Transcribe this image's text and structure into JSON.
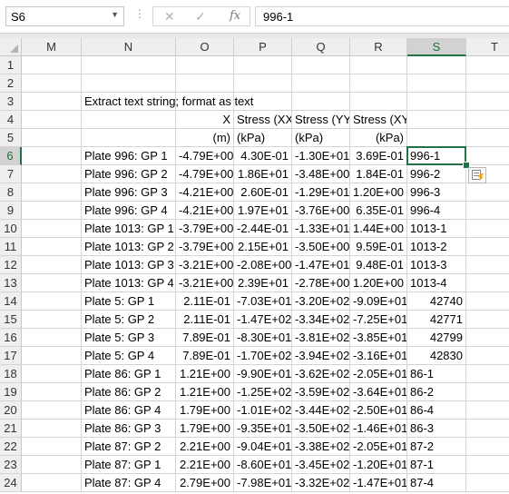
{
  "formula_bar": {
    "name_box": "S6",
    "formula": "996-1",
    "cancel_glyph": "✕",
    "enter_glyph": "✓",
    "fx_label": "fx"
  },
  "columns": [
    "M",
    "N",
    "O",
    "P",
    "Q",
    "R",
    "S",
    "T"
  ],
  "selected_column": "S",
  "selected_row": 6,
  "rows": [
    {
      "n": "1",
      "N": "",
      "O": "",
      "P": "",
      "Q": "",
      "R": "",
      "S": ""
    },
    {
      "n": "2",
      "N": "",
      "O": "",
      "P": "",
      "Q": "",
      "R": "",
      "S": ""
    },
    {
      "n": "3",
      "N": "Extract text string; format as text",
      "O": "",
      "P": "",
      "Q": "",
      "R": "",
      "S": ""
    },
    {
      "n": "4",
      "N": "",
      "O": "X",
      "P": "Stress (XX",
      "Q": "Stress (YY",
      "R": "Stress (XY)",
      "S": ""
    },
    {
      "n": "5",
      "N": "",
      "O": "(m)",
      "P": "(kPa)",
      "Q": "(kPa)",
      "R": "(kPa)",
      "S": ""
    },
    {
      "n": "6",
      "N": "Plate 996: GP 1",
      "O": "-4.79E+00",
      "P": "4.30E-01",
      "Q": "-1.30E+01",
      "R": "3.69E-01",
      "S": "996-1"
    },
    {
      "n": "7",
      "N": "Plate 996: GP 2",
      "O": "-4.79E+00",
      "P": "1.86E+01",
      "Q": "-3.48E+00",
      "R": "1.84E-01",
      "S": "996-2"
    },
    {
      "n": "8",
      "N": "Plate 996: GP 3",
      "O": "-4.21E+00",
      "P": "2.60E-01",
      "Q": "-1.29E+01",
      "R": "1.20E+00",
      "S": "996-3"
    },
    {
      "n": "9",
      "N": "Plate 996: GP 4",
      "O": "-4.21E+00",
      "P": "1.97E+01",
      "Q": "-3.76E+00",
      "R": "6.35E-01",
      "S": "996-4"
    },
    {
      "n": "10",
      "N": "Plate 1013: GP 1",
      "O": "-3.79E+00",
      "P": "-2.44E-01",
      "Q": "-1.33E+01",
      "R": "1.44E+00",
      "S": "1013-1"
    },
    {
      "n": "11",
      "N": "Plate 1013: GP 2",
      "O": "-3.79E+00",
      "P": "2.15E+01",
      "Q": "-3.50E+00",
      "R": "9.59E-01",
      "S": "1013-2"
    },
    {
      "n": "12",
      "N": "Plate 1013: GP 3",
      "O": "-3.21E+00",
      "P": "-2.08E+00",
      "Q": "-1.47E+01",
      "R": "9.48E-01",
      "S": "1013-3"
    },
    {
      "n": "13",
      "N": "Plate 1013: GP 4",
      "O": "-3.21E+00",
      "P": "2.39E+01",
      "Q": "-2.78E+00",
      "R": "1.20E+00",
      "S": "1013-4"
    },
    {
      "n": "14",
      "N": "Plate 5: GP 1",
      "O": "2.11E-01",
      "P": "-7.03E+01",
      "Q": "-3.20E+02",
      "R": "-9.09E+01",
      "S": "42740",
      "s_num": true
    },
    {
      "n": "15",
      "N": "Plate 5: GP 2",
      "O": "2.11E-01",
      "P": "-1.47E+02",
      "Q": "-3.34E+02",
      "R": "-7.25E+01",
      "S": "42771",
      "s_num": true
    },
    {
      "n": "16",
      "N": "Plate 5: GP 3",
      "O": "7.89E-01",
      "P": "-8.30E+01",
      "Q": "-3.81E+02",
      "R": "-3.85E+01",
      "S": "42799",
      "s_num": true
    },
    {
      "n": "17",
      "N": "Plate 5: GP 4",
      "O": "7.89E-01",
      "P": "-1.70E+02",
      "Q": "-3.94E+02",
      "R": "-3.16E+01",
      "S": "42830",
      "s_num": true
    },
    {
      "n": "18",
      "N": "Plate 86: GP 1",
      "O": "1.21E+00",
      "P": "-9.90E+01",
      "Q": "-3.62E+02",
      "R": "-2.05E+01",
      "S": "86-1"
    },
    {
      "n": "19",
      "N": "Plate 86: GP 2",
      "O": "1.21E+00",
      "P": "-1.25E+02",
      "Q": "-3.59E+02",
      "R": "-3.64E+01",
      "S": "86-2"
    },
    {
      "n": "20",
      "N": "Plate 86: GP 4",
      "O": "1.79E+00",
      "P": "-1.01E+02",
      "Q": "-3.44E+02",
      "R": "-2.50E+01",
      "S": "86-4"
    },
    {
      "n": "21",
      "N": "Plate 86: GP 3",
      "O": "1.79E+00",
      "P": "-9.35E+01",
      "Q": "-3.50E+02",
      "R": "-1.46E+01",
      "S": "86-3"
    },
    {
      "n": "22",
      "N": "Plate 87: GP 2",
      "O": "2.21E+00",
      "P": "-9.04E+01",
      "Q": "-3.38E+02",
      "R": "-2.05E+01",
      "S": "87-2"
    },
    {
      "n": "23",
      "N": "Plate 87: GP 1",
      "O": "2.21E+00",
      "P": "-8.60E+01",
      "Q": "-3.45E+02",
      "R": "-1.20E+01",
      "S": "87-1"
    },
    {
      "n": "24",
      "N": "Plate 87: GP 4",
      "O": "2.79E+00",
      "P": "-7.98E+01",
      "Q": "-3.32E+02",
      "R": "-1.47E+01",
      "S": "87-4"
    }
  ],
  "colors": {
    "accent": "#217346",
    "grid": "#d4d4d4",
    "header_bg": "#efefef"
  },
  "icons": {
    "quick_analysis": "quick-analysis-icon",
    "fill_handle": "fill-handle"
  }
}
